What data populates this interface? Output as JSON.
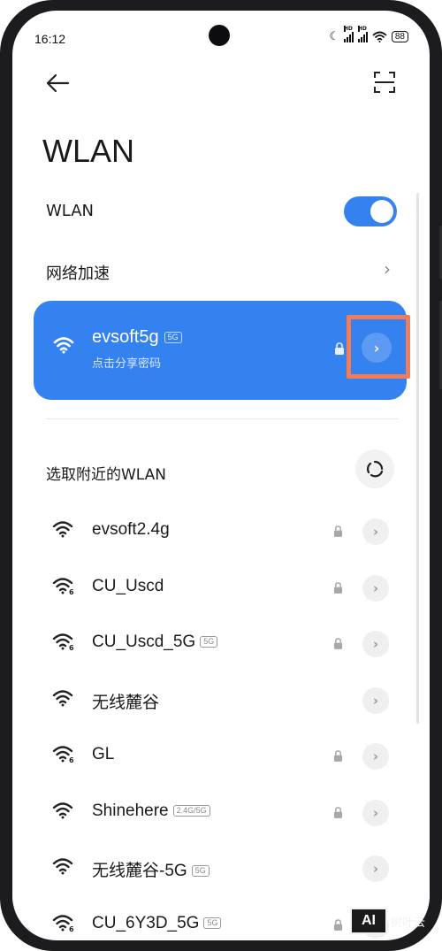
{
  "status_bar": {
    "time": "16:12",
    "battery": "88",
    "sim_label_1": "HD",
    "sim_label_2": "HD"
  },
  "header": {
    "title": "WLAN"
  },
  "wlan_toggle": {
    "label": "WLAN",
    "on": true
  },
  "acceleration": {
    "label": "网络加速"
  },
  "connected": {
    "name": "evsoft5g",
    "band": "5G",
    "subtitle": "点击分享密码",
    "locked": true
  },
  "nearby": {
    "title": "选取附近的WLAN",
    "networks": [
      {
        "name": "evsoft2.4g",
        "band": "",
        "locked": true,
        "icon": "wifi-icon"
      },
      {
        "name": "CU_Uscd",
        "band": "",
        "locked": true,
        "icon": "wifi-6-icon"
      },
      {
        "name": "CU_Uscd_5G",
        "band": "5G",
        "locked": true,
        "icon": "wifi-6-icon"
      },
      {
        "name": "无线麓谷",
        "band": "",
        "locked": false,
        "icon": "wifi-icon"
      },
      {
        "name": "GL",
        "band": "",
        "locked": true,
        "icon": "wifi-6-icon"
      },
      {
        "name": "Shinehere",
        "band": "2.4G/5G",
        "locked": true,
        "icon": "wifi-icon"
      },
      {
        "name": "无线麓谷-5G",
        "band": "5G",
        "locked": false,
        "icon": "wifi-icon"
      },
      {
        "name": "CU_6Y3D_5G",
        "band": "5G",
        "locked": true,
        "icon": "wifi-6-icon"
      }
    ]
  },
  "watermark": {
    "logo": "AI",
    "text": "树叶云"
  },
  "colors": {
    "accent": "#3482f0",
    "highlight_box": "#f07c5c"
  }
}
